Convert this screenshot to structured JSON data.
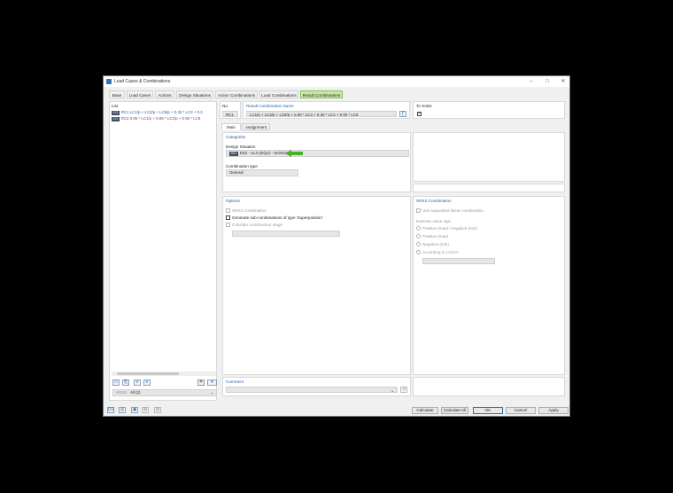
{
  "window": {
    "title": "Load Cases & Combinations"
  },
  "main_tabs": [
    "Base",
    "Load Cases",
    "Actions",
    "Design Situations",
    "Action Combinations",
    "Load Combinations",
    "Result Combinations"
  ],
  "list": {
    "label": "List",
    "rows": [
      {
        "tag": "CO",
        "text": "RC1 LC1/p + LC2/p + LC8/p + 0.30 * LC3 + 0.3",
        "selected": true
      },
      {
        "tag": "CO",
        "text": "RC2 0.95 * LC1/p + 0.95 * LC2/p + 0.95 * LC8",
        "selected": false
      }
    ],
    "filter": "All (2)"
  },
  "no": {
    "label": "No.",
    "value": "RC1"
  },
  "rc_name": {
    "label": "Result Combination Name",
    "value": "LC1/p + LC2/p + LC8/p + 0.30 * LC3 + 0.30 * LC4 + 0.00 * LC6"
  },
  "to_solve": {
    "label": "To Solve"
  },
  "sub_tabs": [
    "Main",
    "Assignment"
  ],
  "categories": {
    "header": "Categories",
    "design_situation_label": "Design Situation",
    "design_situation_tag": "S01",
    "design_situation_value": "DS2 - ULS (EQU) - Seismic",
    "combination_type_label": "Combination type",
    "combination_type_value": "General"
  },
  "options": {
    "header": "Options",
    "srss": "SRSS combination",
    "generate_sub": "Generate sub-combinations of type 'Superposition'",
    "construction_stage": "Consider construction stage"
  },
  "srss_panel": {
    "header": "SRSS Combination",
    "use_equiv": "Use equivalent linear combination",
    "extreme_label": "Extreme value sign",
    "radios": [
      "Positive (max) / negative (min)",
      "Positive (max)",
      "Negative (min)",
      "According to LC/CO"
    ]
  },
  "comment": {
    "label": "Comment"
  },
  "buttons": {
    "calculate": "Calculate",
    "calculate_all": "Calculate All",
    "ok": "OK",
    "cancel": "Cancel",
    "apply": "Apply"
  },
  "colors": {
    "active_tab": "#c8e6a8",
    "accent_blue": "#1f5fa8",
    "arrow": "#4caf2a"
  }
}
